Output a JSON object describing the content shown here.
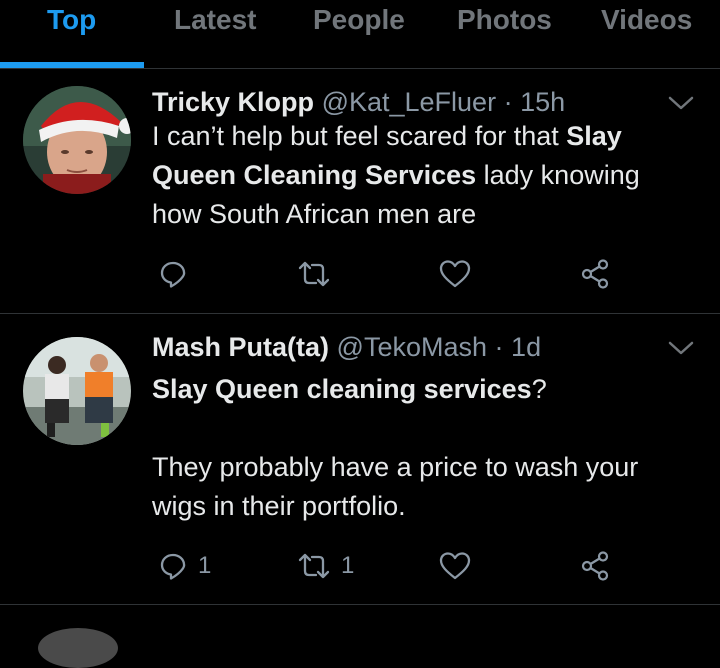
{
  "tabs": [
    {
      "label": "Top",
      "active": true
    },
    {
      "label": "Latest",
      "active": false
    },
    {
      "label": "People",
      "active": false
    },
    {
      "label": "Photos",
      "active": false
    },
    {
      "label": "Videos",
      "active": false
    }
  ],
  "tweets": [
    {
      "author": "Tricky Klopp",
      "handle": "@Kat_LeFluer",
      "separator": "·",
      "time": "15h",
      "text_parts": [
        {
          "text": "I can’t help but feel scared for that ",
          "bold": false
        },
        {
          "text": "Slay Queen Cleaning Services",
          "bold": true
        },
        {
          "text": " lady knowing how South African men are",
          "bold": false
        }
      ],
      "reply_count": "",
      "retweet_count": "",
      "like_count": ""
    },
    {
      "author": "Mash Puta(ta)",
      "handle": "@TekoMash",
      "separator": "·",
      "time": "1d",
      "text_parts": [
        {
          "text": "Slay Queen cleaning services",
          "bold": true
        },
        {
          "text": "?",
          "bold": false
        }
      ],
      "text_second_paragraph": "They probably have a price to wash your wigs in their portfolio.",
      "reply_count": "1",
      "retweet_count": "1",
      "like_count": ""
    }
  ],
  "colors": {
    "background": "#000000",
    "accent": "#1d9bf0",
    "text_primary": "#e7e9ea",
    "text_secondary": "#8b98a5",
    "divider": "#2f3336"
  },
  "icons": [
    "reply-icon",
    "retweet-icon",
    "like-icon",
    "share-icon",
    "chevron-down-icon"
  ]
}
